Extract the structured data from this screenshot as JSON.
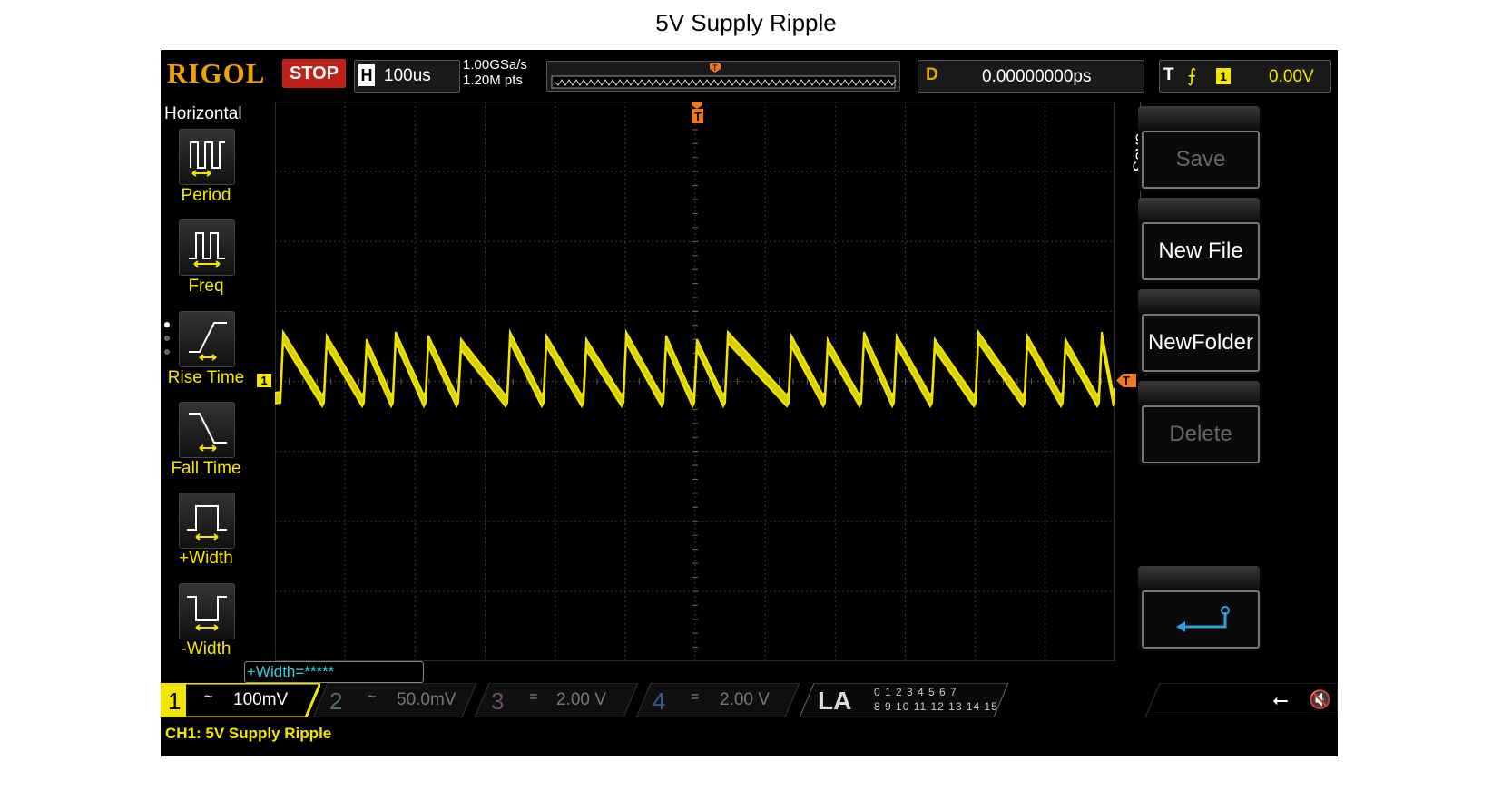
{
  "page_title": "5V Supply Ripple",
  "top_bar": {
    "brand": "RIGOL",
    "run_state": "STOP",
    "horizontal_label": "H",
    "timebase": "100us",
    "sample_rate": "1.00GSa/s",
    "memory_depth": "1.20M pts",
    "trigger_marker": "T",
    "delay_label": "D",
    "delay_value": "0.00000000ps",
    "trigger_label": "T",
    "trigger_source": "1",
    "trigger_level": "0.00V"
  },
  "left_menu": {
    "title": "Horizontal",
    "items": [
      {
        "label": "Period"
      },
      {
        "label": "Freq"
      },
      {
        "label": "Rise Time"
      },
      {
        "label": "Fall Time"
      },
      {
        "label": "+Width"
      },
      {
        "label": "-Width"
      }
    ]
  },
  "right_menu": {
    "title": "Save",
    "save": "Save",
    "new_file": "New File",
    "new_folder": "NewFolder",
    "delete": "Delete"
  },
  "screen": {
    "ch1_marker": "1",
    "trigger_level_marker": "T",
    "trigger_position_marker": "T"
  },
  "status": {
    "measurement": "+Width=*****"
  },
  "channels": [
    {
      "num": "1",
      "coupling": "~",
      "scale": "100mV",
      "color": "#f2e600"
    },
    {
      "num": "2",
      "coupling": "~",
      "scale": "50.0mV",
      "color": "#2fd0e0"
    },
    {
      "num": "3",
      "coupling": "=",
      "scale": "2.00 V",
      "color": "#c040c0"
    },
    {
      "num": "4",
      "coupling": "=",
      "scale": "2.00 V",
      "color": "#3070e0"
    }
  ],
  "logic_analyzer": {
    "label": "LA",
    "row1": "0 1 2 3   4 5 6 7",
    "row2": "8 9 10 11   12 13 14 15"
  },
  "channel_caption": "CH1: 5V Supply Ripple",
  "colors": {
    "ch1": "#f2e600",
    "accent": "#f0a400",
    "stop": "#c0201a"
  }
}
